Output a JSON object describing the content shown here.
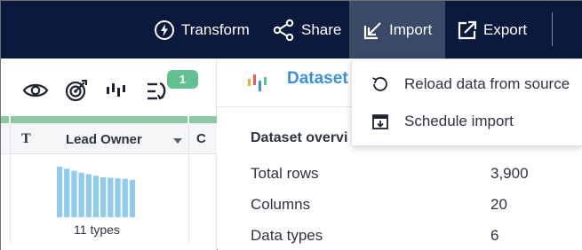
{
  "toolbar": {
    "transform_label": "Transform",
    "share_label": "Share",
    "import_label": "Import",
    "export_label": "Export",
    "transform_icon": "bolt-circle-icon",
    "share_icon": "share-nodes-icon",
    "import_icon": "import-arrow-icon",
    "export_icon": "export-arrow-icon"
  },
  "grid_tools": {
    "icons": [
      "eye-icon",
      "target-icon",
      "chart-bars-icon",
      "rules-icon"
    ],
    "badge_count": "1"
  },
  "column": {
    "type_label": "T",
    "name": "Lead Owner",
    "next_column_fragment": "C",
    "types_summary": "11 types",
    "histogram_values": [
      1.0,
      0.96,
      0.92,
      0.88,
      0.85,
      0.82,
      0.79,
      0.78,
      0.77,
      0.76,
      0.74
    ]
  },
  "dataset": {
    "title": "Dataset",
    "overview_title": "Dataset overvi",
    "stats": [
      {
        "label": "Total rows",
        "value": "3,900"
      },
      {
        "label": "Columns",
        "value": "20"
      },
      {
        "label": "Data types",
        "value": "6"
      }
    ]
  },
  "import_menu": {
    "items": [
      {
        "label": "Reload data from source",
        "icon": "reload-icon"
      },
      {
        "label": "Schedule import",
        "icon": "calendar-download-icon"
      }
    ]
  },
  "colors": {
    "topbar_bg": "#0b1a3c",
    "active_tab_bg": "#3a4a67",
    "accent_green": "#62c28f",
    "histogram_blue": "#8ecbee",
    "title_blue": "#3a8fe0"
  }
}
